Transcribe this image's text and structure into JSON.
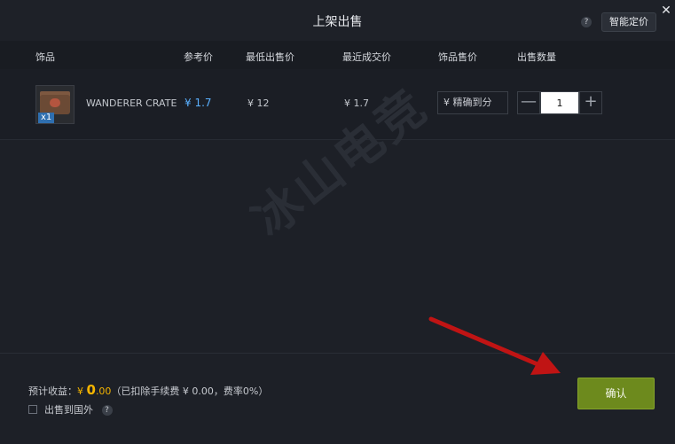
{
  "dialog": {
    "title": "上架出售",
    "smart_pricing_label": "智能定价",
    "help_icon_text": "?",
    "close_symbol": "✕"
  },
  "table": {
    "headers": [
      "饰品",
      "参考价",
      "最低出售价",
      "最近成交价",
      "饰品售价",
      "出售数量"
    ],
    "row": {
      "item_name": "WANDERER CRATE",
      "item_qty_badge": "x1",
      "reference_price": "¥ 1.7",
      "lowest_price": "¥ 12",
      "last_trade_price": "¥ 1.7",
      "price_input_placeholder": "¥  精确到分",
      "quantity": "1",
      "minus_symbol": "—",
      "plus_symbol": "+"
    }
  },
  "watermark": {
    "text": "冰山电竞"
  },
  "footer": {
    "income_label": "预计收益：",
    "income_yen": "¥",
    "income_amount_int": "0",
    "income_amount_dec": ".00",
    "fee_note": "（已扣除手续费 ¥  0.00，费率0%）",
    "sell_abroad_label": "出售到国外",
    "confirm_label": "确认"
  },
  "colors": {
    "accent_blue": "#5ab0ff",
    "income_gold": "#f4b400",
    "confirm_green": "#6d8a1d",
    "arrow_red": "#c01414"
  }
}
